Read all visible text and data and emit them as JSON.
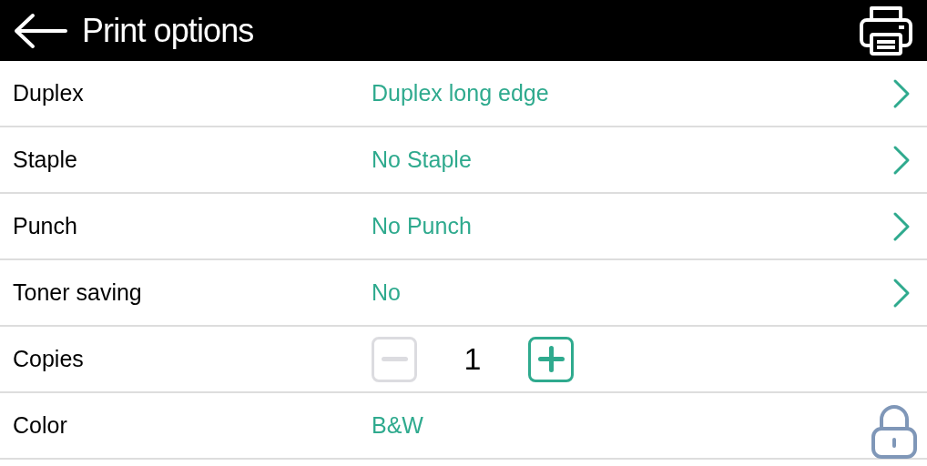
{
  "header": {
    "title": "Print options"
  },
  "rows": [
    {
      "kind": "option",
      "label": "Duplex",
      "value": "Duplex long edge"
    },
    {
      "kind": "option",
      "label": "Staple",
      "value": "No Staple"
    },
    {
      "kind": "option",
      "label": "Punch",
      "value": "No Punch"
    },
    {
      "kind": "option",
      "label": "Toner saving",
      "value": "No"
    },
    {
      "kind": "stepper",
      "label": "Copies",
      "value": "1",
      "decrease_disabled": true,
      "increase_disabled": false
    },
    {
      "kind": "locked",
      "label": "Color",
      "value": "B&W"
    }
  ]
}
